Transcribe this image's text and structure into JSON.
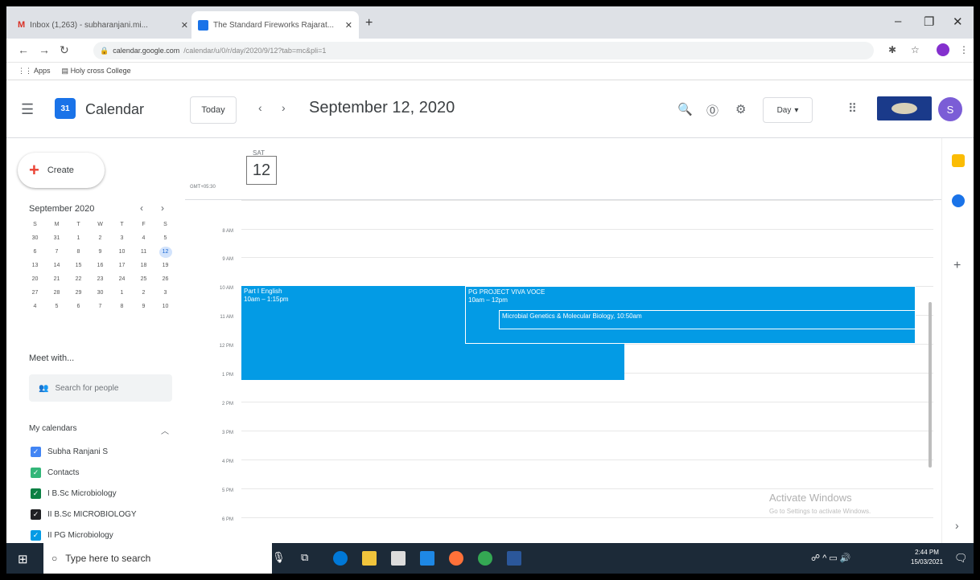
{
  "browser": {
    "tabs": [
      {
        "label": "Inbox (1,263) - subharanjani.mi...",
        "active": false
      },
      {
        "label": "The Standard Fireworks Rajarat...",
        "active": true
      }
    ],
    "url": "calendar.google.com",
    "url_path": "/calendar/u/0/r/day/2020/9/12?tab=mc&pli=1",
    "bookmarks": [
      "Apps",
      "Holy cross College"
    ]
  },
  "header": {
    "app_name": "Calendar",
    "logo_day": "31",
    "today_label": "Today",
    "date_title": "September 12, 2020",
    "view_label": "Day",
    "avatar_letter": "S"
  },
  "sidebar": {
    "create_label": "Create",
    "mini_month": "September 2020",
    "weekdays": [
      "S",
      "M",
      "T",
      "W",
      "T",
      "F",
      "S"
    ],
    "days": [
      [
        "30",
        "31",
        "1",
        "2",
        "3",
        "4",
        "5"
      ],
      [
        "6",
        "7",
        "8",
        "9",
        "10",
        "11",
        "12"
      ],
      [
        "13",
        "14",
        "15",
        "16",
        "17",
        "18",
        "19"
      ],
      [
        "20",
        "21",
        "22",
        "23",
        "24",
        "25",
        "26"
      ],
      [
        "27",
        "28",
        "29",
        "30",
        "1",
        "2",
        "3"
      ],
      [
        "4",
        "5",
        "6",
        "7",
        "8",
        "9",
        "10"
      ]
    ],
    "selected_day": "12",
    "meet_title": "Meet with...",
    "search_placeholder": "Search for people",
    "my_calendars_title": "My calendars",
    "calendars": [
      {
        "name": "Subha Ranjani S",
        "color": "#4285f4"
      },
      {
        "name": "Contacts",
        "color": "#33b679"
      },
      {
        "name": "I B.Sc Microbiology",
        "color": "#0b8043"
      },
      {
        "name": "II B.Sc MICROBIOLOGY",
        "color": "#202124"
      },
      {
        "name": "II PG Microbiology",
        "color": "#039be5"
      }
    ]
  },
  "day": {
    "dow": "SAT",
    "num": "12",
    "timezone": "GMT+05:30",
    "hours": [
      "8 AM",
      "9 AM",
      "10 AM",
      "11 AM",
      "12 PM",
      "1 PM",
      "2 PM",
      "3 PM",
      "4 PM",
      "5 PM",
      "6 PM"
    ],
    "events": [
      {
        "title": "Part I English",
        "time": "10am – 1:15pm"
      },
      {
        "title": "PG PROJECT VIVA VOCE",
        "time": "10am – 12pm"
      },
      {
        "title": "Microbial Genetics & Molecular Biology, 10:50am",
        "time": ""
      }
    ]
  },
  "watermark": {
    "title": "Activate Windows",
    "sub": "Go to Settings to activate Windows."
  },
  "taskbar": {
    "search_placeholder": "Type here to search",
    "time": "2:44 PM",
    "date": "15/03/2021"
  }
}
